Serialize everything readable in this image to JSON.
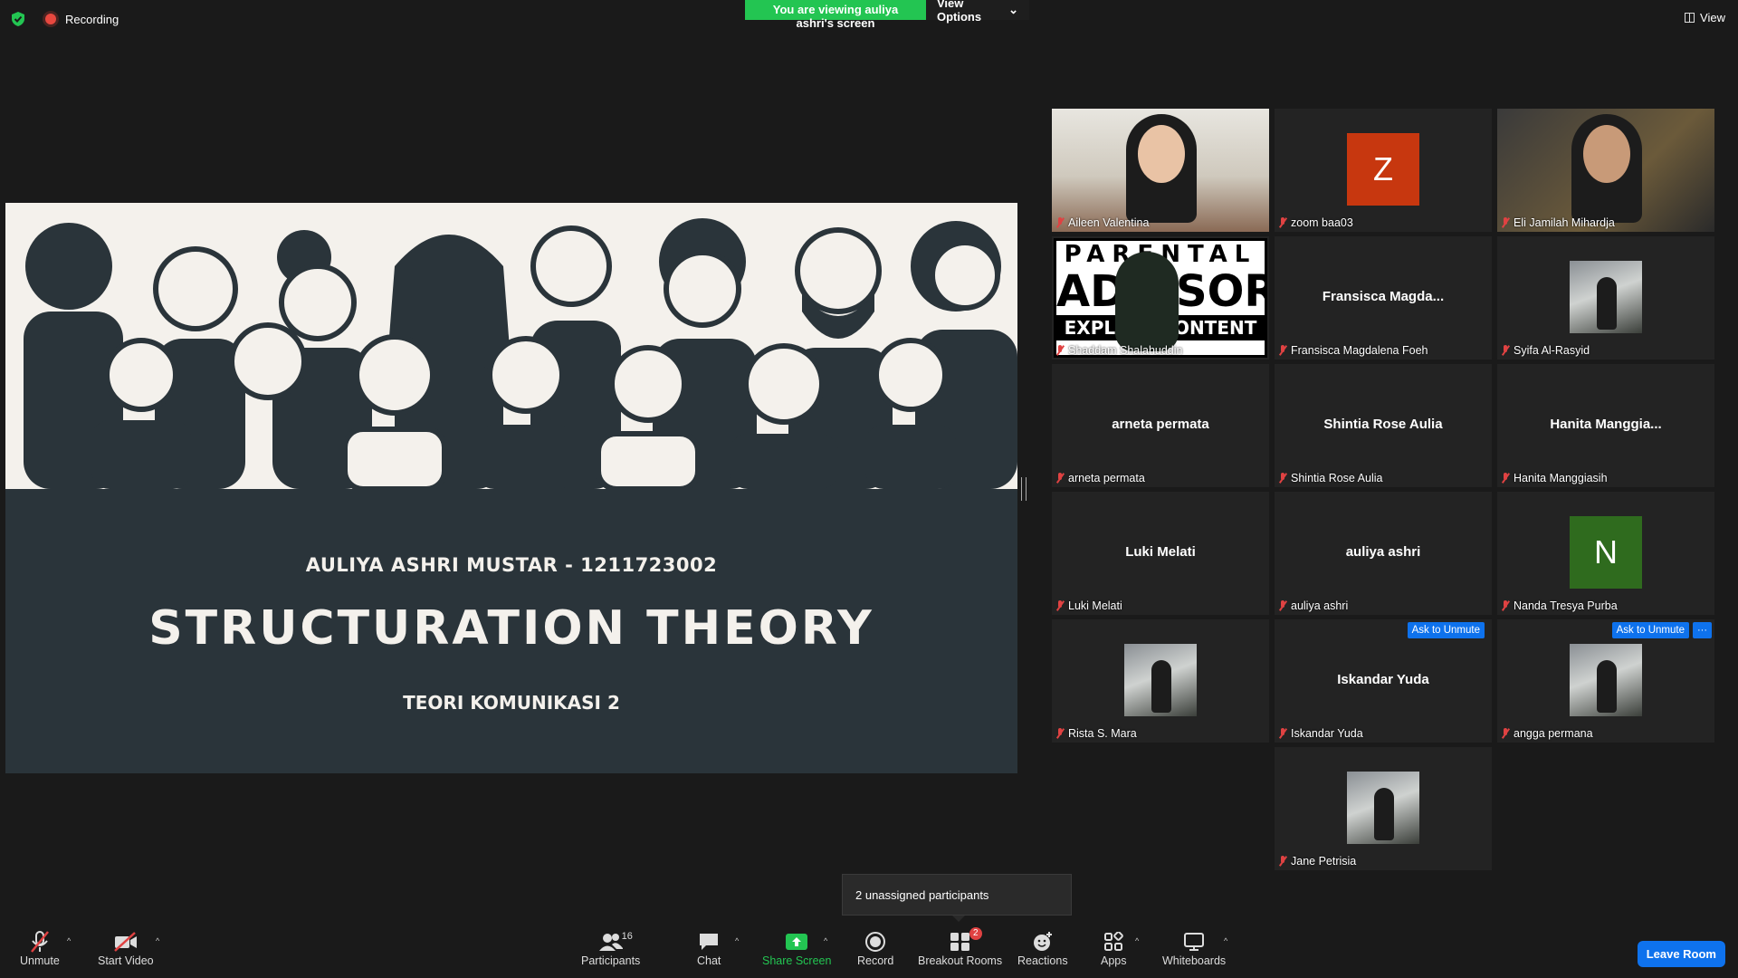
{
  "top": {
    "recording": "Recording",
    "viewing_message": "You are viewing auliya ashri's screen",
    "view_options": "View Options",
    "view": "View"
  },
  "slide": {
    "author": "AULIYA ASHRI MUSTAR - 1211723002",
    "title": "STRUCTURATION THEORY",
    "course": "TEORI KOMUNIKASI 2"
  },
  "participants": [
    {
      "name": "Aileen Valentina",
      "display": "video"
    },
    {
      "name": "zoom baa03",
      "display": "letter",
      "letter": "Z",
      "color": "#c7370f"
    },
    {
      "name": "Eli Jamilah Mihardja",
      "display": "video",
      "active": true
    },
    {
      "name": "Shaddam Shalahuddin",
      "display": "poster",
      "poster_top": "PARENTAL",
      "poster_mid": "ADVISORY",
      "poster_bot": "EXPLICIT CONTENT"
    },
    {
      "name": "Fransisca Magdalena Foeh",
      "display": "name",
      "center": "Fransisca  Magda..."
    },
    {
      "name": "Syifa Al-Rasyid",
      "display": "photo"
    },
    {
      "name": "arneta permata",
      "display": "name",
      "center": "arneta permata"
    },
    {
      "name": "Shintia Rose Aulia",
      "display": "name",
      "center": "Shintia Rose Aulia"
    },
    {
      "name": "Hanita Manggiasih",
      "display": "name",
      "center": "Hanita  Manggia..."
    },
    {
      "name": "Luki Melati",
      "display": "name",
      "center": "Luki Melati"
    },
    {
      "name": "auliya ashri",
      "display": "name",
      "center": "auliya ashri"
    },
    {
      "name": "Nanda Tresya Purba",
      "display": "letter",
      "letter": "N",
      "color": "#2f6b1e"
    },
    {
      "name": "Rista S. Mara",
      "display": "photo"
    },
    {
      "name": "Iskandar Yuda",
      "display": "name",
      "center": "Iskandar Yuda",
      "ask_unmute": "Ask to Unmute"
    },
    {
      "name": "angga permana",
      "display": "photo",
      "ask_unmute": "Ask to Unmute",
      "more": "···"
    },
    {
      "name": "Jane Petrisia",
      "display": "photo"
    }
  ],
  "tooltip": "2 unassigned participants",
  "toolbar": {
    "unmute": "Unmute",
    "start_video": "Start Video",
    "participants": "Participants",
    "participants_count": "16",
    "chat": "Chat",
    "share_screen": "Share Screen",
    "record": "Record",
    "breakout_rooms": "Breakout Rooms",
    "breakout_badge": "2",
    "reactions": "Reactions",
    "apps": "Apps",
    "whiteboards": "Whiteboards",
    "leave_room": "Leave Room"
  },
  "colors": {
    "accent_blue": "#0e72ed",
    "share_green": "#23c552",
    "active_speaker": "#d6e85a",
    "mute_red": "#e04242"
  }
}
